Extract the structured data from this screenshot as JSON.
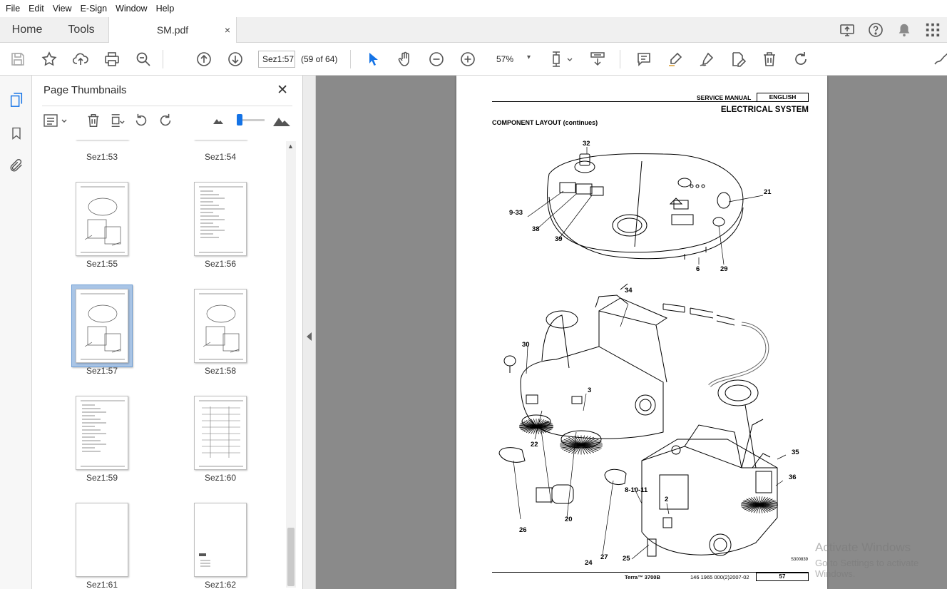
{
  "menu": [
    "File",
    "Edit",
    "View",
    "E-Sign",
    "Window",
    "Help"
  ],
  "tabs": {
    "home": "Home",
    "tools": "Tools",
    "document": "SM.pdf",
    "close": "×"
  },
  "toolbar": {
    "page_label": "Sez1:57",
    "page_count": "(59 of 64)",
    "zoom": "57%",
    "zoom_caret": "▾"
  },
  "thumbnails": {
    "title": "Page Thumbnails",
    "close": "✕",
    "pages": [
      {
        "label": "Sez1:53"
      },
      {
        "label": "Sez1:54"
      },
      {
        "label": "Sez1:55"
      },
      {
        "label": "Sez1:56"
      },
      {
        "label": "Sez1:57",
        "selected": true
      },
      {
        "label": "Sez1:58"
      },
      {
        "label": "Sez1:59"
      },
      {
        "label": "Sez1:60"
      },
      {
        "label": "Sez1:61"
      },
      {
        "label": "Sez1:62"
      }
    ]
  },
  "page": {
    "header_label": "SERVICE MANUAL",
    "language": "ENGLISH",
    "section": "ELECTRICAL SYSTEM",
    "subtitle": "COMPONENT LAYOUT (continues)",
    "footer_model": "Terra™ 3700B",
    "footer_code": "146 1965 000(2)2007-02",
    "page_number": "57",
    "drawing_ref": "S300839",
    "callouts": [
      "32",
      "21",
      "9-33",
      "38",
      "39",
      "6",
      "29",
      "34",
      "30",
      "3",
      "8-10-11",
      "2",
      "36",
      "35",
      "22",
      "20",
      "26",
      "27",
      "24",
      "25"
    ]
  },
  "watermark": {
    "line1": "Activate Windows",
    "line2": "Go to Settings to activate Windows."
  }
}
